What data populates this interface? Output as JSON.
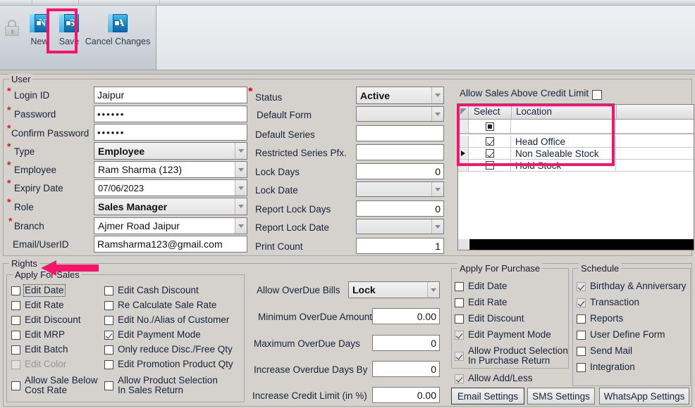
{
  "ribbon": {
    "buttons": [
      {
        "name": "new",
        "label": "New",
        "glyph": "N"
      },
      {
        "name": "save",
        "label": "Save",
        "glyph": "S"
      },
      {
        "name": "cancel-changes",
        "label": "Cancel Changes",
        "glyph": "A"
      }
    ],
    "lock_icon": "lock-icon"
  },
  "annotations": {
    "save_highlight_color": "#f4156b",
    "grid_highlight_color": "#f4156b",
    "arrow_color": "#f4156b",
    "arrow_target": "Rights"
  },
  "user_group": {
    "title": "User",
    "fields": [
      {
        "label": "Login ID",
        "required": true,
        "value": "Jaipur",
        "type": "text"
      },
      {
        "label": "Password",
        "required": true,
        "value": "••••••",
        "type": "password"
      },
      {
        "label": "Confirm Password",
        "required": true,
        "value": "••••••",
        "type": "password"
      },
      {
        "label": "Type",
        "required": true,
        "value": "Employee",
        "type": "combo-bold"
      },
      {
        "label": "Employee",
        "required": true,
        "value": "Ram Sharma (123)",
        "type": "combo"
      },
      {
        "label": "Expiry Date",
        "required": true,
        "value": "07/06/2023",
        "type": "combo-date"
      },
      {
        "label": "Role",
        "required": true,
        "value": "Sales Manager",
        "type": "combo-bold"
      },
      {
        "label": "Branch",
        "required": true,
        "value": "Ajmer Road Jaipur",
        "type": "combo"
      },
      {
        "label": "Email/UserID",
        "required": false,
        "value": "Ramsharma123@gmail.com",
        "type": "text"
      }
    ],
    "fields_mid": [
      {
        "label": "Status",
        "required": true,
        "value": "Active",
        "type": "combo-bold"
      },
      {
        "label": "Default Form",
        "required": false,
        "value": "",
        "type": "combo-disabled"
      },
      {
        "label": "Default Series",
        "required": false,
        "value": "",
        "type": "text"
      },
      {
        "label": "Restricted Series Pfx.",
        "required": false,
        "value": "",
        "type": "text"
      },
      {
        "label": "Lock Days",
        "required": false,
        "value": "0",
        "type": "number"
      },
      {
        "label": "Lock Date",
        "required": false,
        "value": "",
        "type": "combo-disabled"
      },
      {
        "label": "Report Lock Days",
        "required": false,
        "value": "0",
        "type": "number"
      },
      {
        "label": "Report Lock Date",
        "required": false,
        "value": "",
        "type": "combo-disabled"
      },
      {
        "label": "Print Count",
        "required": false,
        "value": "1",
        "type": "number"
      }
    ]
  },
  "credit": {
    "allow_sales_above_credit_limit_label": "Allow Sales Above Credit Limit",
    "allow_sales_above_credit_limit_checked": false
  },
  "location_grid": {
    "columns": [
      "Select",
      "Location"
    ],
    "filter_row_state": "partial",
    "rows": [
      {
        "select": true,
        "location": "Head Office",
        "current": false
      },
      {
        "select": true,
        "location": "Non Saleable Stock",
        "current": true
      },
      {
        "select": false,
        "location": "Hold Stock",
        "current": false
      }
    ]
  },
  "rights": {
    "title": "Rights",
    "apply_for_sales": {
      "title": "Apply For Sales",
      "col1": [
        {
          "label": "Edit Date",
          "checked": false,
          "disabled": false,
          "focused": true
        },
        {
          "label": "Edit Rate",
          "checked": false,
          "disabled": false,
          "focused": false
        },
        {
          "label": "Edit Discount",
          "checked": false,
          "disabled": false,
          "focused": false
        },
        {
          "label": "Edit MRP",
          "checked": false,
          "disabled": false,
          "focused": false
        },
        {
          "label": "Edit Batch",
          "checked": false,
          "disabled": false,
          "focused": false
        },
        {
          "label": "Edit Color",
          "checked": false,
          "disabled": true,
          "focused": false
        },
        {
          "label": "Allow Sale Below\nCost Rate",
          "checked": false,
          "disabled": false,
          "focused": false
        }
      ],
      "col2": [
        {
          "label": "Edit Cash Discount",
          "checked": false
        },
        {
          "label": "Re Calculate Sale Rate",
          "checked": false
        },
        {
          "label": "Edit No./Alias of Customer",
          "checked": false
        },
        {
          "label": "Edit Payment Mode",
          "checked": true
        },
        {
          "label": "Only reduce Disc./Free Qty",
          "checked": false
        },
        {
          "label": "Edit Promotion Product Qty",
          "checked": false
        },
        {
          "label": "Allow Product Selection\nIn Sales Return",
          "checked": false
        }
      ]
    },
    "overdue": {
      "allow_overdue_bills_label": "Allow OverDue Bills",
      "allow_overdue_bills_value": "Lock",
      "fields": [
        {
          "label": "Minimum OverDue Amount",
          "value": "0.00"
        },
        {
          "label": "Maximum OverDue Days",
          "value": "0"
        },
        {
          "label": "Increase Overdue Days By",
          "value": "0"
        },
        {
          "label": "Increase Credit Limit (in %)",
          "value": "0.00"
        }
      ]
    },
    "apply_for_purchase": {
      "title": "Apply For Purchase",
      "items": [
        {
          "label": "Edit Date",
          "checked": false
        },
        {
          "label": "Edit Rate",
          "checked": false
        },
        {
          "label": "Edit Discount",
          "checked": false
        },
        {
          "label": "Edit Payment Mode",
          "checked": true
        },
        {
          "label": "Allow Product Selection\nIn Purchase Return",
          "checked": true
        }
      ],
      "outside": [
        {
          "label": "Allow Add/Less",
          "checked": true
        }
      ]
    },
    "schedule": {
      "title": "Schedule",
      "items": [
        {
          "label": "Birthday & Anniversary",
          "checked": true
        },
        {
          "label": "Transaction",
          "checked": true
        },
        {
          "label": "Reports",
          "checked": false
        },
        {
          "label": "User Define Form",
          "checked": false
        },
        {
          "label": "Send Mail",
          "checked": false
        },
        {
          "label": "Integration",
          "checked": false
        }
      ]
    },
    "buttons": [
      {
        "label": "Email Settings"
      },
      {
        "label": "SMS Settings"
      },
      {
        "label": "WhatsApp Settings"
      }
    ]
  }
}
